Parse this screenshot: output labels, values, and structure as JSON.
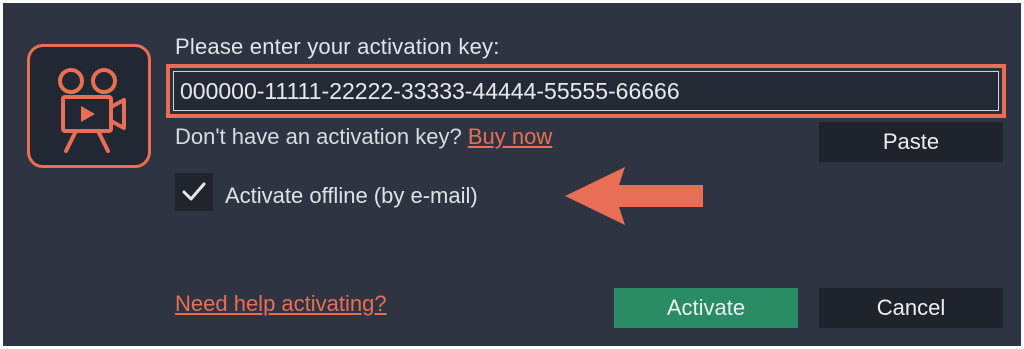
{
  "dialog": {
    "prompt": "Please enter your activation key:",
    "key_value": "000000-11111-22222-33333-44444-55555-66666",
    "no_key_text": "Don't have an activation key?",
    "buy_link": "Buy now",
    "paste_label": "Paste",
    "offline_label": "Activate offline (by e-mail)",
    "offline_checked": true,
    "help_link": "Need help activating?",
    "activate_label": "Activate",
    "cancel_label": "Cancel"
  },
  "icons": {
    "logo": "video-editor-logo-icon",
    "check": "checkmark-icon",
    "annotation": "arrow-left-icon"
  },
  "colors": {
    "background": "#2e3441",
    "accent": "#e86f55",
    "activate_button": "#2a8c65",
    "secondary_button": "#1e232c"
  }
}
